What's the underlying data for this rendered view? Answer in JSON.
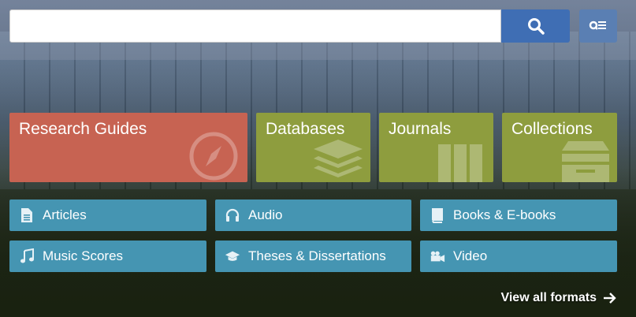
{
  "search": {
    "value": "",
    "placeholder": "",
    "search_icon": "search-icon",
    "advanced_icon": "advanced-search-icon"
  },
  "tiles": [
    {
      "label": "Research Guides",
      "icon": "compass-icon",
      "color": "#c76352"
    },
    {
      "label": "Databases",
      "icon": "layers-icon",
      "color": "#8e9d3e"
    },
    {
      "label": "Journals",
      "icon": "books-icon",
      "color": "#8e9d3e"
    },
    {
      "label": "Collections",
      "icon": "archive-box-icon",
      "color": "#8e9d3e"
    }
  ],
  "formats": [
    {
      "label": "Articles",
      "icon": "document-icon"
    },
    {
      "label": "Audio",
      "icon": "headphones-icon"
    },
    {
      "label": "Books & E-books",
      "icon": "book-icon"
    },
    {
      "label": "Music Scores",
      "icon": "music-note-icon"
    },
    {
      "label": "Theses & Dissertations",
      "icon": "graduation-cap-icon"
    },
    {
      "label": "Video",
      "icon": "video-camera-icon"
    }
  ],
  "view_all": {
    "label": "View all formats",
    "icon": "arrow-right-icon"
  },
  "colors": {
    "format_button": "#4595b2",
    "search_button": "#3f6eb4"
  }
}
